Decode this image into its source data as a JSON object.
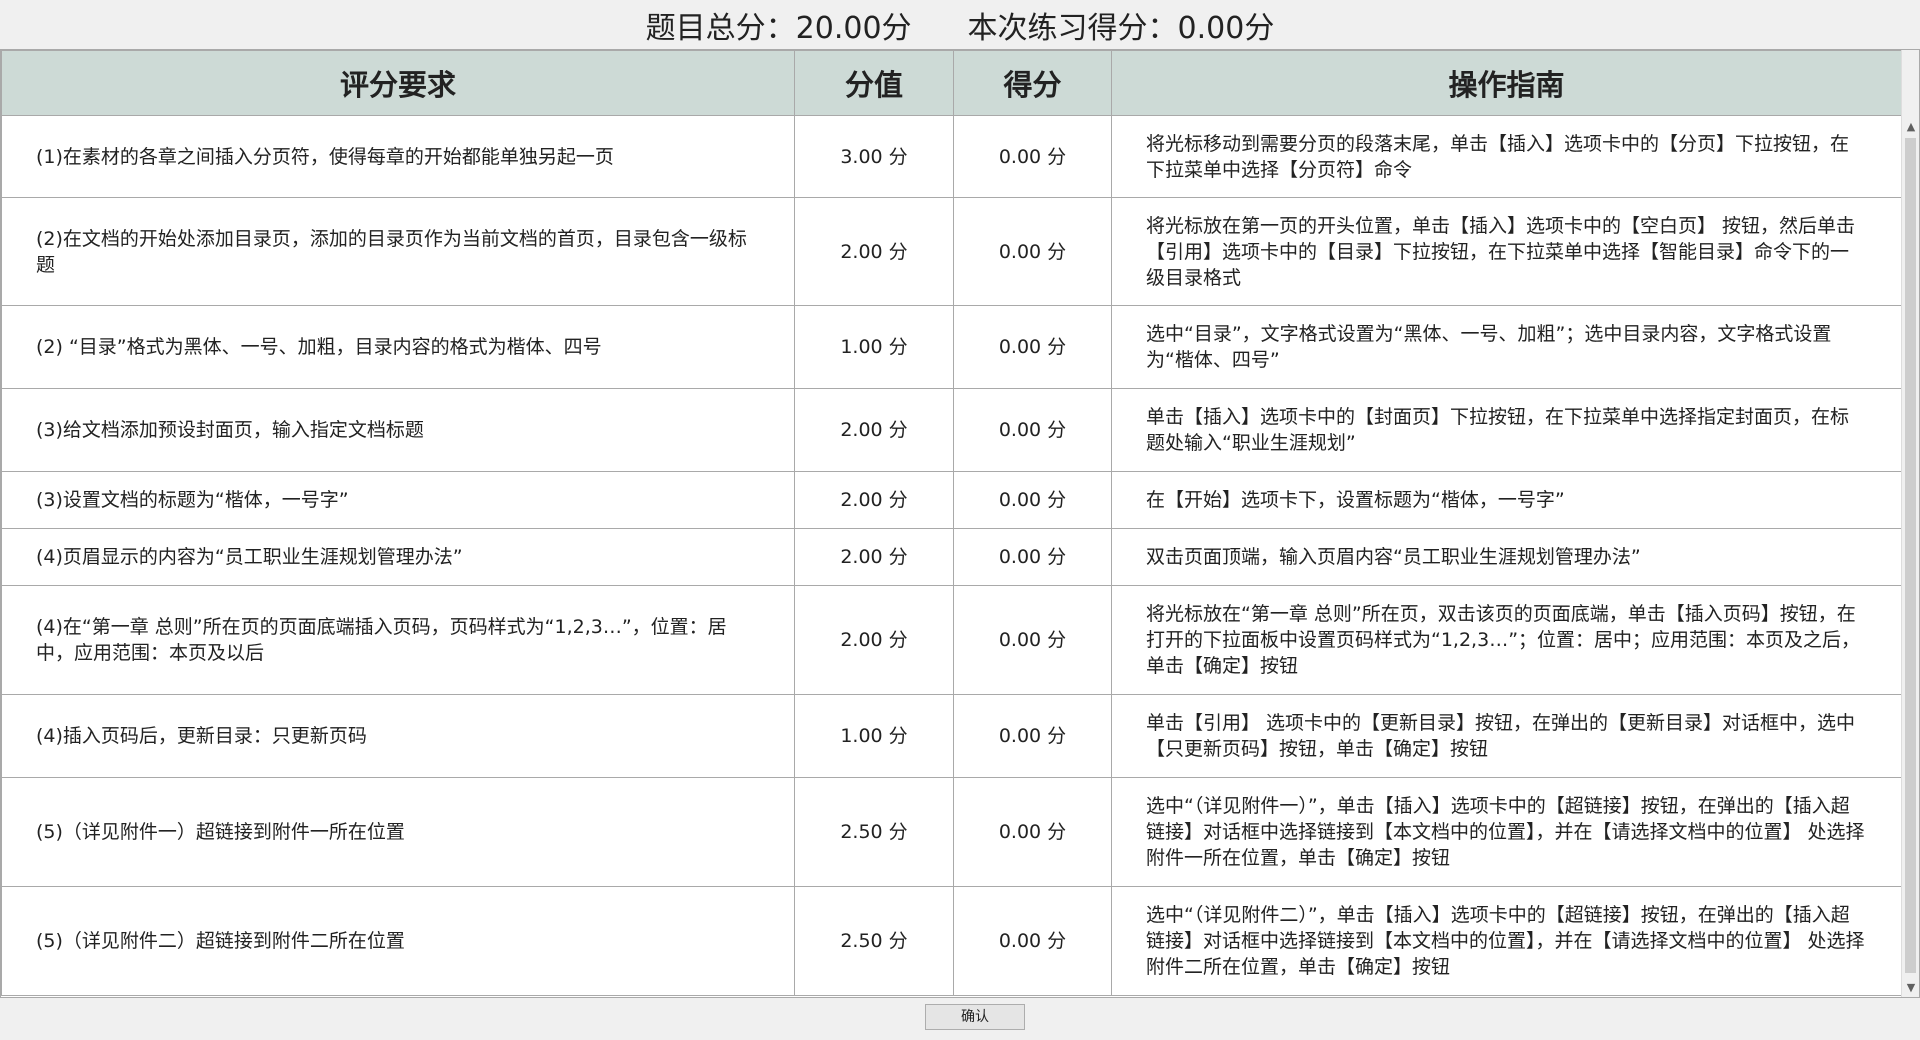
{
  "header": {
    "total_score": "题目总分：20.00分",
    "practice_score": "本次练习得分：0.00分"
  },
  "table": {
    "columns": [
      "评分要求",
      "分值",
      "得分",
      "操作指南"
    ],
    "rows": [
      {
        "req": "(1)在素材的各章之间插入分页符，使得每章的开始都能单独另起一页",
        "value": "3.00 分",
        "score": "0.00 分",
        "guide": "将光标移动到需要分页的段落末尾，单击【插入】选项卡中的【分页】下拉按钮，在下拉菜单中选择【分页符】命令"
      },
      {
        "req": "(2)在文档的开始处添加目录页，添加的目录页作为当前文档的首页，目录包含一级标题",
        "value": "2.00 分",
        "score": "0.00 分",
        "guide": "将光标放在第一页的开头位置，单击【插入】选项卡中的【空白页】 按钮，然后单击【引用】选项卡中的【目录】下拉按钮，在下拉菜单中选择【智能目录】命令下的一级目录格式"
      },
      {
        "req": "(2) “目录”格式为黑体、一号、加粗，目录内容的格式为楷体、四号",
        "value": "1.00 分",
        "score": "0.00 分",
        "guide": "选中“目录”，文字格式设置为“黑体、一号、加粗”；选中目录内容，文字格式设置为“楷体、四号”"
      },
      {
        "req": "(3)给文档添加预设封面页，输入指定文档标题",
        "value": "2.00 分",
        "score": "0.00 分",
        "guide": "单击【插入】选项卡中的【封面页】下拉按钮，在下拉菜单中选择指定封面页，在标题处输入“职业生涯规划”"
      },
      {
        "req": "(3)设置文档的标题为“楷体，一号字”",
        "value": "2.00 分",
        "score": "0.00 分",
        "guide": "在【开始】选项卡下，设置标题为“楷体，一号字”"
      },
      {
        "req": "(4)页眉显示的内容为“员工职业生涯规划管理办法”",
        "value": "2.00 分",
        "score": "0.00 分",
        "guide": "双击页面顶端，输入页眉内容“员工职业生涯规划管理办法”"
      },
      {
        "req": "(4)在“第一章 总则”所在页的页面底端插入页码，页码样式为“1,2,3…”，位置：居中，应用范围：本页及以后",
        "value": "2.00 分",
        "score": "0.00 分",
        "guide": "将光标放在“第一章 总则”所在页，双击该页的页面底端，单击【插入页码】按钮，在打开的下拉面板中设置页码样式为“1,2,3…”；位置：居中；应用范围：本页及之后，单击【确定】按钮"
      },
      {
        "req": "(4)插入页码后，更新目录：只更新页码",
        "value": "1.00 分",
        "score": "0.00 分",
        "guide": "单击【引用】 选项卡中的【更新目录】按钮，在弹出的【更新目录】对话框中，选中【只更新页码】按钮，单击【确定】按钮"
      },
      {
        "req": "(5)（详见附件一）超链接到附件一所在位置",
        "value": "2.50 分",
        "score": "0.00 分",
        "guide": "选中“（详见附件一）”，单击【插入】选项卡中的【超链接】按钮，在弹出的【插入超链接】对话框中选择链接到【本文档中的位置】，并在【请选择文档中的位置】 处选择附件一所在位置，单击【确定】按钮"
      },
      {
        "req": "(5)（详见附件二）超链接到附件二所在位置",
        "value": "2.50 分",
        "score": "0.00 分",
        "guide": "选中“（详见附件二）”，单击【插入】选项卡中的【超链接】按钮，在弹出的【插入超链接】对话框中选择链接到【本文档中的位置】，并在【请选择文档中的位置】 处选择附件二所在位置，单击【确定】按钮"
      }
    ]
  },
  "footer": {
    "confirm_label": "确认"
  },
  "icons": {
    "scroll_up": "scroll-up-arrow-icon",
    "scroll_down": "scroll-down-arrow-icon"
  },
  "colors": {
    "header_bg": "#cddad6",
    "grid_line": "#a9a9a9"
  }
}
